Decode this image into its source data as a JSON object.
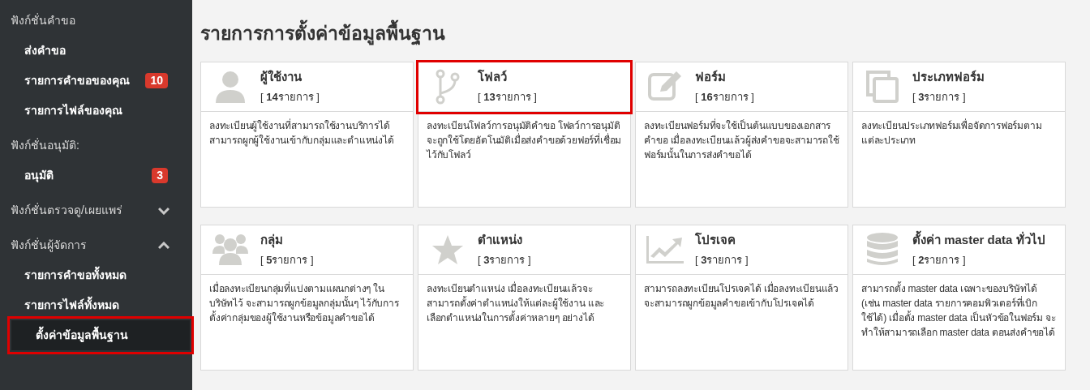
{
  "sidebar": {
    "groups": [
      {
        "title": "ฟังก์ชั่นคำขอ",
        "items": [
          {
            "label": "ส่งคำขอ",
            "selected": false,
            "highlighted": false
          },
          {
            "label": "รายการคำขอของคุณ",
            "badge": "10",
            "selected": false,
            "highlighted": false
          },
          {
            "label": "รายการไฟล์ของคุณ",
            "selected": false,
            "highlighted": false
          }
        ]
      },
      {
        "title": "ฟังก์ชั่นอนุมัติ:",
        "items": [
          {
            "label": "อนุมัติ",
            "badge": "3",
            "selected": false,
            "highlighted": false
          }
        ]
      },
      {
        "title": "ฟังก์ชั่นตรวจดู/เผยแพร่",
        "expanded": false
      },
      {
        "title": "ฟังก์ชั่นผู้จัดการ",
        "expanded": true,
        "items": [
          {
            "label": "รายการคำขอทั้งหมด",
            "selected": false,
            "highlighted": false
          },
          {
            "label": "รายการไฟล์ทั้งหมด",
            "selected": false,
            "highlighted": false
          },
          {
            "label": "ตั้งค่าข้อมูลพื้นฐาน",
            "selected": true,
            "highlighted": true
          }
        ]
      }
    ]
  },
  "page_title": "รายการการตั้งค่าข้อมูลพื้นฐาน",
  "cards": [
    {
      "kind": "user",
      "title": "ผู้ใช้งาน",
      "count": "[ **14**รายการ ]",
      "description": "ลงทะเบียนผู้ใช้งานที่สามารถใช้งานบริการได้ สามารถผูกผู้ใช้งานเข้ากับกลุ่มและตำแหน่งได้",
      "highlighted": false
    },
    {
      "kind": "flow",
      "title": "โฟลว์",
      "count": "[ **13**รายการ ]",
      "description": "ลงทะเบียนโฟลว์การอนุมัติคำขอ โฟลว์การอนุมัติจะถูกใช้โดยอัตโนมัติเมื่อส่งคำขอด้วยฟอร์ที่เชื่อมไว้กับโฟลว์",
      "highlighted": true
    },
    {
      "kind": "form",
      "title": "ฟอร์ม",
      "count": "[ **16**รายการ ]",
      "description": "ลงทะเบียนฟอร์มที่จะใช้เป็นต้นแบบของเอกสารคำขอ เมื่อลงทะเบียนแล้วผู้ส่งคำขอจะสามารถใช้ฟอร์มนั้นในการส่งคำขอได้",
      "highlighted": false
    },
    {
      "kind": "copy",
      "title": "ประเภทฟอร์ม",
      "count": "[ **3**รายการ ]",
      "description": "ลงทะเบียนประเภทฟอร์มเพื่อจัดการฟอร์มตามแต่ละประเภท",
      "highlighted": false
    },
    {
      "kind": "group",
      "title": "กลุ่ม",
      "count": "[ **5**รายการ ]",
      "description": "เมื่อลงทะเบียนกลุ่มที่แบ่งตามแผนกต่างๆ ในบริษัทไว้ จะสามารถผูกข้อมูลกลุ่มนั้นๆ ไว้กับการตั้งค่ากลุ่มของผู้ใช้งานหรือข้อมูลคำขอได้",
      "highlighted": false
    },
    {
      "kind": "star",
      "title": "ตำแหน่ง",
      "count": "[ **3**รายการ ]",
      "description": "ลงทะเบียนตำแหน่ง เมื่อลงทะเบียนแล้วจะสามารถตั้งค่าตำแหน่งให้แต่ละผู้ใช้งาน และเลือกตำแหน่งในการตั้งค่าหลายๆ อย่างได้",
      "highlighted": false
    },
    {
      "kind": "chart",
      "title": "โปรเจค",
      "count": "[ **3**รายการ ]",
      "description": "สามารถลงทะเบียนโปรเจคได้ เมื่อลงทะเบียนแล้วจะสามารถผูกข้อมูลคำขอเข้ากับโปรเจคได้",
      "highlighted": false
    },
    {
      "kind": "database",
      "title": "ตั้งค่า master data ทั่วไป",
      "count": "[ **2**รายการ ]",
      "description": "สามารถตั้ง master data เฉพาะของบริษัทได้ (เช่น master data รายการคอมพิวเตอร์ที่เบิกใช้ได้) เมื่อตั้ง master data เป็นหัวข้อในฟอร์ม จะทำให้สามารถเลือก master data ตอนส่งคำขอได้",
      "highlighted": false
    }
  ]
}
